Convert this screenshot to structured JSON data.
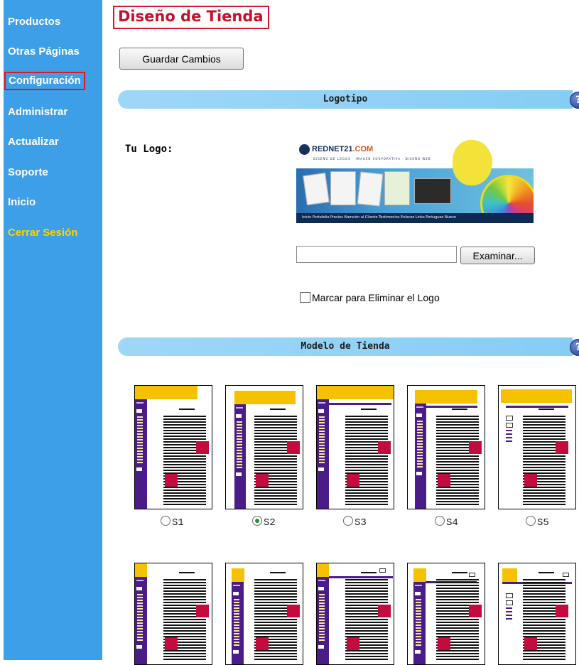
{
  "sidebar": {
    "items": [
      {
        "label": "Productos"
      },
      {
        "label": "Otras Páginas"
      },
      {
        "label": "Configuración"
      },
      {
        "label": "Administrar"
      },
      {
        "label": "Actualizar"
      },
      {
        "label": "Soporte"
      },
      {
        "label": "Inicio"
      },
      {
        "label": "Cerrar Sesión"
      }
    ]
  },
  "page": {
    "title": "Diseño de Tienda",
    "save_label": "Guardar Cambios"
  },
  "logo_section": {
    "title": "Logotipo",
    "help": "?",
    "label": "Tu Logo:",
    "logo_brand": "REDNET21",
    "logo_brand_suffix": ".COM",
    "logo_tagline": "DISEÑO DE LOGOS · IMAGEN CORPORATIVA · DISEÑO WEB",
    "logo_footer": "Inicio  Portafolio  Precios  Atención al Cliente  Testimonios  Enlaces  Links  Portugues  Nuevo",
    "file_value": "",
    "browse_label": "Examinar...",
    "delete_label": "Marcar para Eliminar el Logo",
    "delete_checked": false
  },
  "model_section": {
    "title": "Modelo de Tienda",
    "help": "?",
    "selected": "S2",
    "templates_row1": [
      {
        "label": "S1",
        "checked": false
      },
      {
        "label": "S2",
        "checked": true
      },
      {
        "label": "S3",
        "checked": false
      },
      {
        "label": "S4",
        "checked": false
      },
      {
        "label": "S5",
        "checked": false
      }
    ]
  },
  "colors": {
    "sidebar": "#3e9fe9",
    "title": "#c8102e",
    "band": "#f6c200",
    "purple": "#4a1c88",
    "red": "#c40b3d"
  }
}
